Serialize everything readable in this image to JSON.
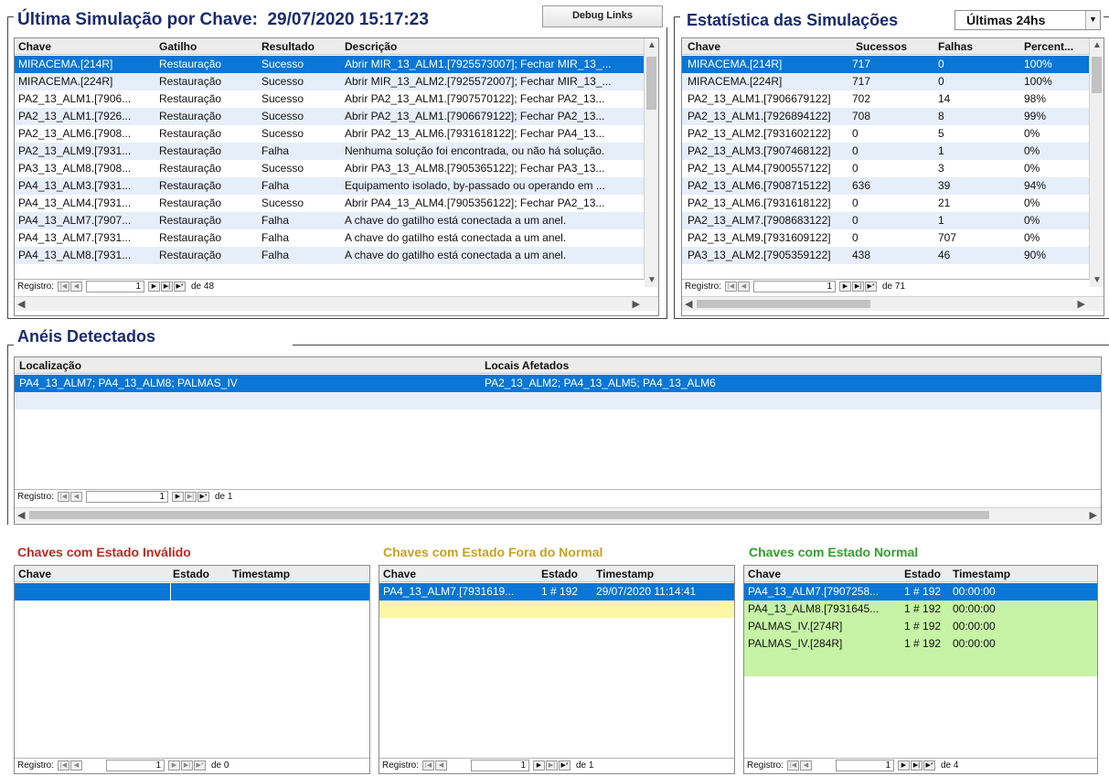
{
  "last_sim": {
    "title": "Última Simulação por Chave:",
    "timestamp": "29/07/2020 15:17:23",
    "debug_label": "Debug Links",
    "columns": [
      "Chave",
      "Gatilho",
      "Resultado",
      "Descrição"
    ],
    "rows": [
      [
        "MIRACEMA.[214R]",
        "Restauração",
        "Sucesso",
        "Abrir MIR_13_ALM1.[7925573007]; Fechar MIR_13_..."
      ],
      [
        "MIRACEMA.[224R]",
        "Restauração",
        "Sucesso",
        "Abrir MIR_13_ALM2.[7925572007]; Fechar MIR_13_..."
      ],
      [
        "PA2_13_ALM1.[7906...",
        "Restauração",
        "Sucesso",
        "Abrir PA2_13_ALM1.[7907570122]; Fechar PA2_13..."
      ],
      [
        "PA2_13_ALM1.[7926...",
        "Restauração",
        "Sucesso",
        "Abrir PA2_13_ALM1.[7906679122]; Fechar PA2_13..."
      ],
      [
        "PA2_13_ALM6.[7908...",
        "Restauração",
        "Sucesso",
        "Abrir PA2_13_ALM6.[7931618122]; Fechar PA4_13..."
      ],
      [
        "PA2_13_ALM9.[7931...",
        "Restauração",
        "Falha",
        "Nenhuma solução foi encontrada, ou não há solução."
      ],
      [
        "PA3_13_ALM8.[7908...",
        "Restauração",
        "Sucesso",
        "Abrir PA3_13_ALM8.[7905365122]; Fechar PA3_13..."
      ],
      [
        "PA4_13_ALM3.[7931...",
        "Restauração",
        "Falha",
        "Equipamento isolado, by-passado ou operando em ..."
      ],
      [
        "PA4_13_ALM4.[7931...",
        "Restauração",
        "Sucesso",
        "Abrir PA4_13_ALM4.[7905356122]; Fechar PA2_13..."
      ],
      [
        "PA4_13_ALM7.[7907...",
        "Restauração",
        "Falha",
        "A chave do gatilho está conectada a um anel."
      ],
      [
        "PA4_13_ALM7.[7931...",
        "Restauração",
        "Falha",
        "A chave do gatilho está conectada a um anel."
      ],
      [
        "PA4_13_ALM8.[7931...",
        "Restauração",
        "Falha",
        "A chave do gatilho está conectada a um anel."
      ]
    ],
    "nav": {
      "label": "Registro:",
      "current": "1",
      "count": "de 48"
    }
  },
  "stats": {
    "title": "Estatística das Simulações",
    "period_selected": "Últimas 24hs",
    "columns": [
      "Chave",
      "Sucessos",
      "Falhas",
      "Percent..."
    ],
    "rows": [
      [
        "MIRACEMA.[214R]",
        "717",
        "0",
        "100%"
      ],
      [
        "MIRACEMA.[224R]",
        "717",
        "0",
        "100%"
      ],
      [
        "PA2_13_ALM1.[7906679122]",
        "702",
        "14",
        "98%"
      ],
      [
        "PA2_13_ALM1.[7926894122]",
        "708",
        "8",
        "99%"
      ],
      [
        "PA2_13_ALM2.[7931602122]",
        "0",
        "5",
        "0%"
      ],
      [
        "PA2_13_ALM3.[7907468122]",
        "0",
        "1",
        "0%"
      ],
      [
        "PA2_13_ALM4.[7900557122]",
        "0",
        "3",
        "0%"
      ],
      [
        "PA2_13_ALM6.[7908715122]",
        "636",
        "39",
        "94%"
      ],
      [
        "PA2_13_ALM6.[7931618122]",
        "0",
        "21",
        "0%"
      ],
      [
        "PA2_13_ALM7.[7908683122]",
        "0",
        "1",
        "0%"
      ],
      [
        "PA2_13_ALM9.[7931609122]",
        "0",
        "707",
        "0%"
      ],
      [
        "PA3_13_ALM2.[7905359122]",
        "438",
        "46",
        "90%"
      ]
    ],
    "nav": {
      "label": "Registro:",
      "current": "1",
      "count": "de 71"
    }
  },
  "rings": {
    "title": "Anéis Detectados",
    "columns": [
      "Localização",
      "Locais Afetados"
    ],
    "rows": [
      [
        "PA4_13_ALM7; PA4_13_ALM8; PALMAS_IV",
        "PA2_13_ALM2; PA4_13_ALM5; PA4_13_ALM6"
      ]
    ],
    "nav": {
      "label": "Registro:",
      "current": "1",
      "count": "de 1"
    }
  },
  "invalid": {
    "title": "Chaves com Estado Inválido",
    "title_color": "#c0281f",
    "columns": [
      "Chave",
      "Estado",
      "Timestamp"
    ],
    "rows": [],
    "nav": {
      "label": "Registro:",
      "current": "1",
      "count": "de 0"
    }
  },
  "abnormal": {
    "title": "Chaves com Estado Fora do Normal",
    "title_color": "#c9a21c",
    "columns": [
      "Chave",
      "Estado",
      "Timestamp"
    ],
    "rows": [
      [
        "PA4_13_ALM7.[7931619...",
        "1 # 192",
        "29/07/2020 11:14:41"
      ]
    ],
    "nav": {
      "label": "Registro:",
      "current": "1",
      "count": "de 1"
    }
  },
  "normal": {
    "title": "Chaves com Estado Normal",
    "title_color": "#2fa22a",
    "columns": [
      "Chave",
      "Estado",
      "Timestamp"
    ],
    "rows": [
      [
        "PA4_13_ALM7.[7907258...",
        "1 # 192",
        "00:00:00"
      ],
      [
        "PA4_13_ALM8.[7931645...",
        "1 # 192",
        "00:00:00"
      ],
      [
        "PALMAS_IV.[274R]",
        "1 # 192",
        "00:00:00"
      ],
      [
        "PALMAS_IV.[284R]",
        "1 # 192",
        "00:00:00"
      ]
    ],
    "nav": {
      "label": "Registro:",
      "current": "1",
      "count": "de 4"
    }
  },
  "colors": {
    "selection": "#0a76d6",
    "title_blue": "#1a2b6e",
    "abnormal_row": "#fbf6a8",
    "normal_row": "#c6f3a6"
  }
}
